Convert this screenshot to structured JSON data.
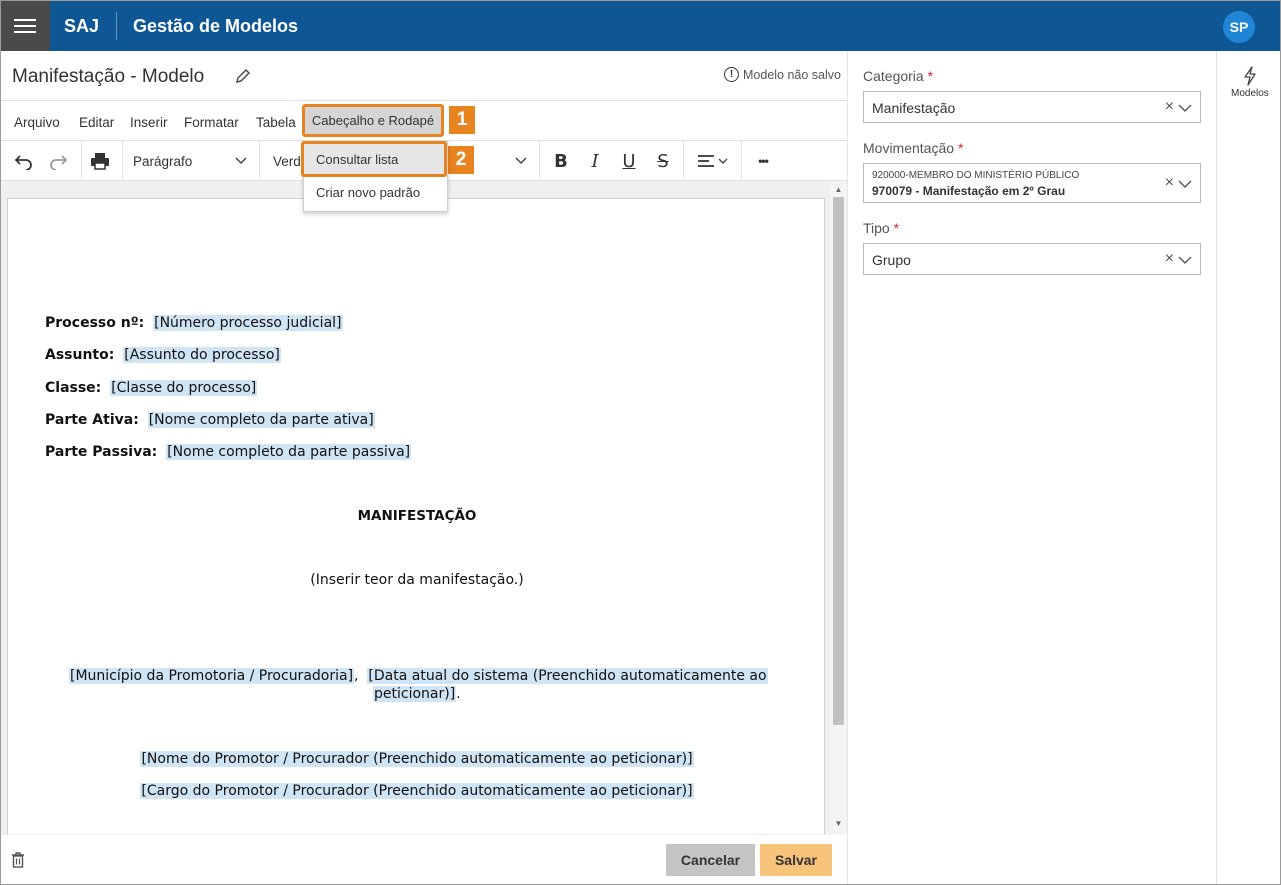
{
  "header": {
    "brand": "SAJ",
    "app_title": "Gestão de Modelos",
    "avatar_initials": "SP"
  },
  "editor": {
    "doc_title": "Manifestação - Modelo",
    "unsaved_label": "Modelo não salvo",
    "menu": [
      "Arquivo",
      "Editar",
      "Inserir",
      "Formatar",
      "Tabela",
      "Cabeçalho e Rodapé"
    ],
    "callouts": [
      "1",
      "2"
    ],
    "toolbar": {
      "paragraph_style": "Parágrafo",
      "font_family_visible": "Verd",
      "bold": "B",
      "italic": "I",
      "underline": "U",
      "strike": "S",
      "more": "•••"
    },
    "dropdown": {
      "items": [
        "Consultar lista",
        "Criar novo padrão"
      ]
    }
  },
  "document": {
    "fields": [
      {
        "label": "Processo nº:",
        "value": "[Número processo judicial]"
      },
      {
        "label": "Assunto:",
        "value": "[Assunto do processo]"
      },
      {
        "label": "Classe:",
        "value": "[Classe do processo]"
      },
      {
        "label": "Parte Ativa:",
        "value": "[Nome completo da parte ativa]"
      },
      {
        "label": "Parte Passiva:",
        "value": "[Nome completo da parte passiva]"
      }
    ],
    "heading": "MANIFESTAÇÃO",
    "body_placeholder": "(Inserir teor da manifestação.)",
    "place_field": "[Município da Promotoria / Procuradoria]",
    "place_sep": ",",
    "date_field_line1": "[Data atual do sistema (Preenchido automaticamente ao",
    "date_field_line2": "peticionar)]",
    "date_end": ".",
    "signature_name": "[Nome do Promotor / Procurador (Preenchido automaticamente ao peticionar)]",
    "signature_role": "[Cargo do Promotor / Procurador (Preenchido automaticamente ao peticionar)]"
  },
  "actions": {
    "cancel": "Cancelar",
    "save": "Salvar"
  },
  "form": {
    "categoria": {
      "label": "Categoria",
      "required": "*",
      "value": "Manifestação"
    },
    "movimentacao": {
      "label": "Movimentação",
      "required": "*",
      "code_line": "920000-MEMBRO DO MINISTÉRIO PÚBLICO",
      "value_line": "970079 - Manifestação em 2º Grau"
    },
    "tipo": {
      "label": "Tipo",
      "required": "*",
      "value": "Grupo"
    }
  },
  "side_panel": {
    "label": "Modelos",
    "icon": "lightning-icon"
  },
  "colors": {
    "topbar": "#0f5694",
    "callout": "#e8841f",
    "field_highlight": "#cfe4f4",
    "save_button": "#f7c27a",
    "required": "#d9252b"
  }
}
